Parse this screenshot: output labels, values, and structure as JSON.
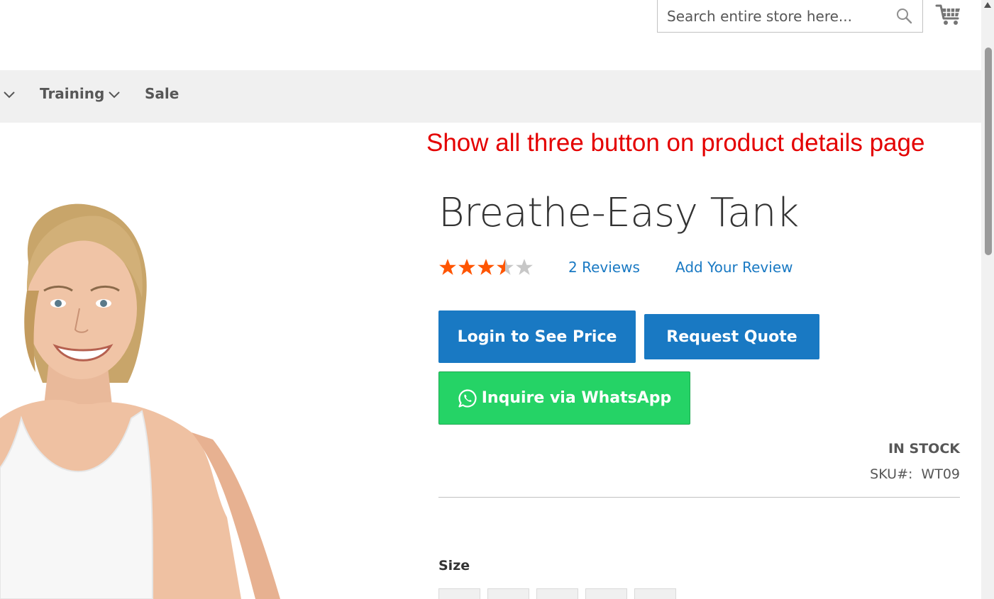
{
  "header": {
    "search_placeholder": "Search entire store here...",
    "search_icon": "magnifier-icon",
    "cart_icon": "shopping-cart-icon"
  },
  "nav": {
    "items": [
      {
        "label": "Training",
        "has_dropdown": true
      },
      {
        "label": "Sale",
        "has_dropdown": false
      }
    ]
  },
  "annotation": {
    "text": "Show all three button on product details page",
    "color": "#e40000"
  },
  "product": {
    "title": "Breathe-Easy Tank",
    "rating_stars": 3.5,
    "rating_max": 5,
    "reviews_link": "2  Reviews",
    "add_review_link": "Add Your Review",
    "stock_status": "IN STOCK",
    "sku_label": "SKU#:",
    "sku_value": "WT09",
    "size_label": "Size"
  },
  "buttons": {
    "login_price": "Login to See Price",
    "request_quote": "Request Quote",
    "whatsapp": "Inquire via WhatsApp"
  },
  "colors": {
    "primary_blue": "#1979c3",
    "whatsapp_green": "#25d366",
    "star_orange": "#ff5501",
    "star_gray": "#c7c7c7",
    "nav_bg": "#f0f0f0"
  }
}
